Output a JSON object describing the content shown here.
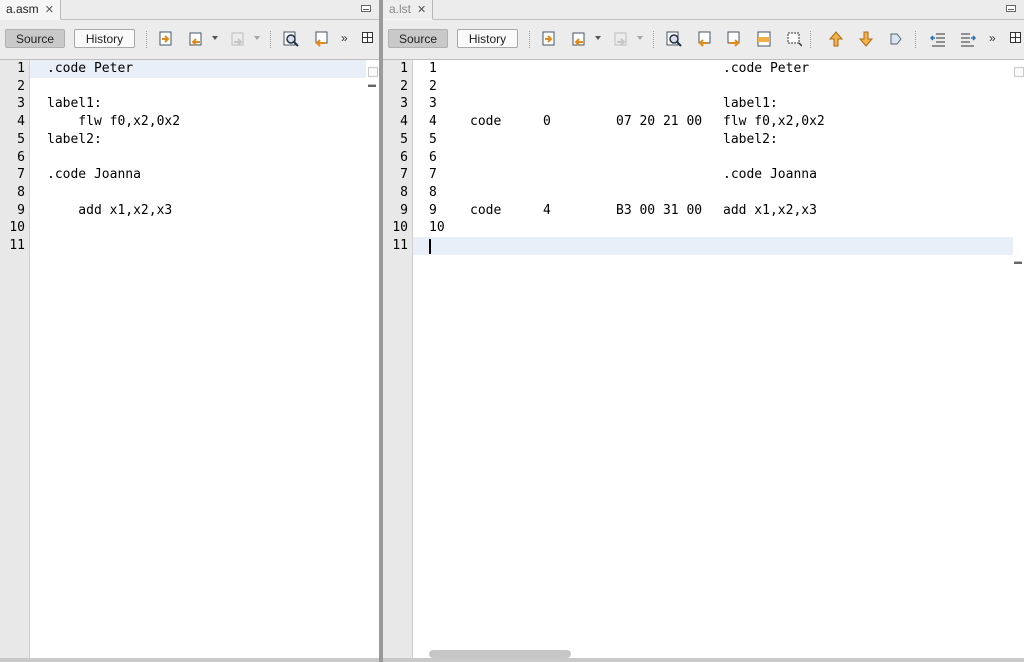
{
  "colors": {
    "line_highlight": "#e9eff8",
    "gutter_bg": "#e8e8e8",
    "active_button": "#c9c9c9"
  },
  "left": {
    "tab": {
      "title": "a.asm",
      "close": "✕"
    },
    "toolbar": {
      "source_label": "Source",
      "history_label": "History"
    },
    "icons": [
      "last-edit-icon",
      "back-icon",
      "forward-icon",
      "find-icon",
      "previous-occurrence-icon",
      "more-icon",
      "split-icon"
    ],
    "line_numbers": [
      "1",
      "2",
      "3",
      "4",
      "5",
      "6",
      "7",
      "8",
      "9",
      "10",
      "11"
    ],
    "lines": [
      ".code Peter",
      "",
      "label1:",
      "    flw f0,x2,0x2",
      "label2:",
      "",
      ".code Joanna",
      "",
      "    add x1,x2,x3",
      "",
      ""
    ]
  },
  "right": {
    "tab": {
      "title": "a.lst",
      "close": "✕"
    },
    "toolbar": {
      "source_label": "Source",
      "history_label": "History"
    },
    "icons": [
      "last-edit-icon",
      "back-icon",
      "forward-icon",
      "find-icon",
      "previous-occurrence-icon",
      "next-occurrence-icon",
      "selected-occurrence-icon",
      "rectangular-selection-icon",
      "previous-bookmark-icon",
      "next-bookmark-icon",
      "toggle-bookmark-icon",
      "shift-left-icon",
      "shift-right-icon",
      "more-icon",
      "split-icon"
    ],
    "line_numbers": [
      "1",
      "2",
      "3",
      "4",
      "5",
      "6",
      "7",
      "8",
      "9",
      "10",
      "11"
    ],
    "rows": [
      {
        "num": "1",
        "seg": "",
        "off": "",
        "bytes": "",
        "src": ".code Peter"
      },
      {
        "num": "2",
        "seg": "",
        "off": "",
        "bytes": "",
        "src": ""
      },
      {
        "num": "3",
        "seg": "",
        "off": "",
        "bytes": "",
        "src": "label1:"
      },
      {
        "num": "4",
        "seg": "code",
        "off": "0",
        "bytes": "07 20 21 00",
        "src": "flw f0,x2,0x2"
      },
      {
        "num": "5",
        "seg": "",
        "off": "",
        "bytes": "",
        "src": "label2:"
      },
      {
        "num": "6",
        "seg": "",
        "off": "",
        "bytes": "",
        "src": ""
      },
      {
        "num": "7",
        "seg": "",
        "off": "",
        "bytes": "",
        "src": ".code Joanna"
      },
      {
        "num": "8",
        "seg": "",
        "off": "",
        "bytes": "",
        "src": ""
      },
      {
        "num": "9",
        "seg": "code",
        "off": "4",
        "bytes": "B3 00 31 00",
        "src": "add x1,x2,x3"
      },
      {
        "num": "10",
        "seg": "",
        "off": "",
        "bytes": "",
        "src": ""
      },
      {
        "num": "",
        "seg": "",
        "off": "",
        "bytes": "",
        "src": ""
      }
    ]
  }
}
